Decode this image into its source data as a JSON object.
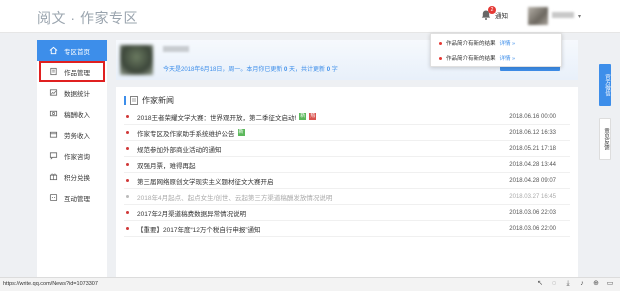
{
  "header": {
    "brand": "阅文 · 作家专区",
    "notification_count": "2",
    "notification_label": "通知"
  },
  "sidebar": {
    "items": [
      {
        "label": "专区首页",
        "icon": "home-icon"
      },
      {
        "label": "作品管理",
        "icon": "book-icon"
      },
      {
        "label": "数据统计",
        "icon": "chart-icon"
      },
      {
        "label": "稿酬收入",
        "icon": "money-icon"
      },
      {
        "label": "劳务收入",
        "icon": "wallet-icon"
      },
      {
        "label": "作家咨询",
        "icon": "chat-icon"
      },
      {
        "label": "积分兑换",
        "icon": "gift-icon"
      },
      {
        "label": "互动管理",
        "icon": "interact-icon"
      }
    ]
  },
  "profile": {
    "stats_prefix": "今天是2018年6月18日，周一。本月你已更新",
    "stats_month": "0",
    "stats_mid": "天，共计更新",
    "stats_total": "0",
    "stats_suffix": "字",
    "write_button": "写"
  },
  "popup": {
    "items": [
      {
        "text": "作品简介有新的结果",
        "more": "详情 »"
      },
      {
        "text": "作品简介有新的结果",
        "more": "详情 »"
      }
    ]
  },
  "news": {
    "title": "作家新闻",
    "rows": [
      {
        "title": "2018王者荣耀文学大赛：世界观开放，第二季征文启动!",
        "date": "2018.06.16 00:00",
        "tags": [
          "新",
          "热"
        ],
        "grey": false
      },
      {
        "title": "作家专区及作家助手系统维护公告",
        "date": "2018.06.12 16:33",
        "tags": [
          "新"
        ],
        "grey": false
      },
      {
        "title": "规范参加外部商业活动的通知",
        "date": "2018.05.21 17:18",
        "tags": [],
        "grey": false
      },
      {
        "title": "双强月票，难得再起",
        "date": "2018.04.28 13:44",
        "tags": [],
        "grey": false
      },
      {
        "title": "第三届网络原创文学现实主义题材征文大赛开启",
        "date": "2018.04.28 09:07",
        "tags": [],
        "grey": false
      },
      {
        "title": "2018年4月起点、起点女生/创世、云起第三方渠道稿酬发放情况说明",
        "date": "2018.03.27 16:45",
        "tags": [],
        "grey": true
      },
      {
        "title": "2017年2月渠道稿费数据异常情况说明",
        "date": "2018.03.06 22:03",
        "tags": [],
        "grey": false
      },
      {
        "title": "【重要】2017年度“12万个税自行申报”通知",
        "date": "2018.03.06 22:00",
        "tags": [],
        "grey": false
      }
    ]
  },
  "float_tabs": {
    "tab1": "官方微信",
    "tab2": "意见反馈"
  },
  "status": {
    "url": "https://write.qq.com/News?id=1073307"
  },
  "colors": {
    "accent": "#3d8eea",
    "highlight_border": "#e02020",
    "bullet": "#d03838"
  }
}
